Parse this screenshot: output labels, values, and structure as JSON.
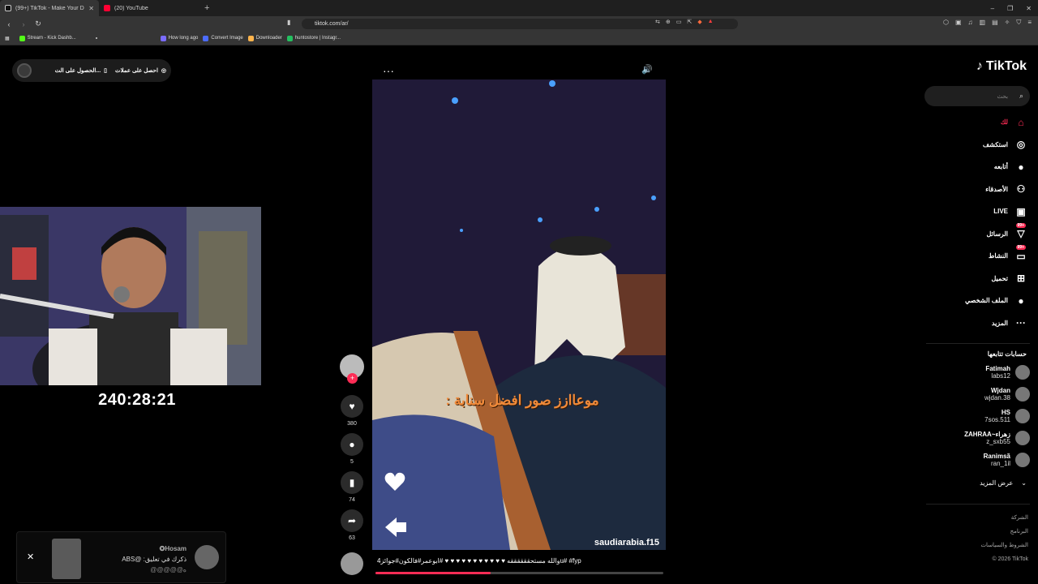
{
  "browser": {
    "tabs": [
      {
        "title": "(99+) TikTok - Make Your Day",
        "active": true
      },
      {
        "title": "(20) YouTube",
        "active": false
      }
    ],
    "new_tab": "+",
    "window_controls": [
      "–",
      "❐",
      "✕"
    ],
    "url": "tiktok.com/ar/",
    "bookmarks": [
      {
        "label": "Stream - Kick Dashb...",
        "color": "#53fc18"
      },
      {
        "label": "How long ago",
        "color": "#7a6cff"
      },
      {
        "label": "Convert Image",
        "color": "#4c6cff"
      },
      {
        "label": "Downloader",
        "color": "#ffb44c"
      },
      {
        "label": "huntostore | Instagr...",
        "color": "#24c060"
      }
    ]
  },
  "promo_pill": {
    "item1": "احصل على عملات",
    "item2": "الحصول على الت..."
  },
  "webcam": {
    "timer": "240:28:21"
  },
  "video": {
    "more_icon": "···",
    "sound_icon": "🔊",
    "caption_overlay": "موعاازز صور افضل سنابة :",
    "watermark": "saudiarabia.f15",
    "description": "والله مستحققققققه ♥ ♥ ♥ ♥ ♥ ♥ ♥ ♥ ♥ ♥ ♥ #ابوعمر#فالكون#جوائز4u# #fyp",
    "progress": 0.4
  },
  "actions": {
    "likes": "380",
    "comments": "5",
    "saves": "74",
    "shares": "63"
  },
  "sidebar": {
    "logo": "TikTok",
    "search_placeholder": "بحث",
    "nav": [
      {
        "label": "لك",
        "icon": "home-icon",
        "glyph": "⌂",
        "active": true
      },
      {
        "label": "استكشف",
        "icon": "compass-icon",
        "glyph": "◎"
      },
      {
        "label": "أتابعه",
        "icon": "following-avatar-icon",
        "glyph": "●"
      },
      {
        "label": "الأصدقاء",
        "icon": "friends-icon",
        "glyph": "⚇"
      },
      {
        "label": "LIVE",
        "icon": "live-icon",
        "glyph": "▣"
      },
      {
        "label": "الرسائل",
        "icon": "messages-icon",
        "glyph": "▽",
        "badge": "+99"
      },
      {
        "label": "النشاط",
        "icon": "activity-icon",
        "glyph": "▭",
        "badge": "+99"
      },
      {
        "label": "تحميل",
        "icon": "upload-icon",
        "glyph": "⊞"
      },
      {
        "label": "الملف الشخصي",
        "icon": "profile-icon",
        "glyph": "●"
      },
      {
        "label": "المزيد",
        "icon": "more-icon",
        "glyph": "···"
      }
    ],
    "following_title": "حسابات تتابعها",
    "following": [
      {
        "name": "Fatimah",
        "handle": "labs12"
      },
      {
        "name": "Wjdan",
        "handle": "wjdan.38"
      },
      {
        "name": "HS",
        "handle": "7sos.511"
      },
      {
        "name": "ZAHRAA~زهراء",
        "handle": "z_sxb55"
      },
      {
        "name": "Ranimsã",
        "handle": "ran_1il"
      }
    ],
    "see_more": "عرض المزيد",
    "footer": [
      "الشركة",
      "البرنامج",
      "الشروط والسياسات",
      "© 2026 TikTok"
    ]
  },
  "toast": {
    "close": "✕",
    "user": "Hosam✪",
    "text": "ذكرك في تعليق: @ABS",
    "extra": "ه@@@@@"
  }
}
